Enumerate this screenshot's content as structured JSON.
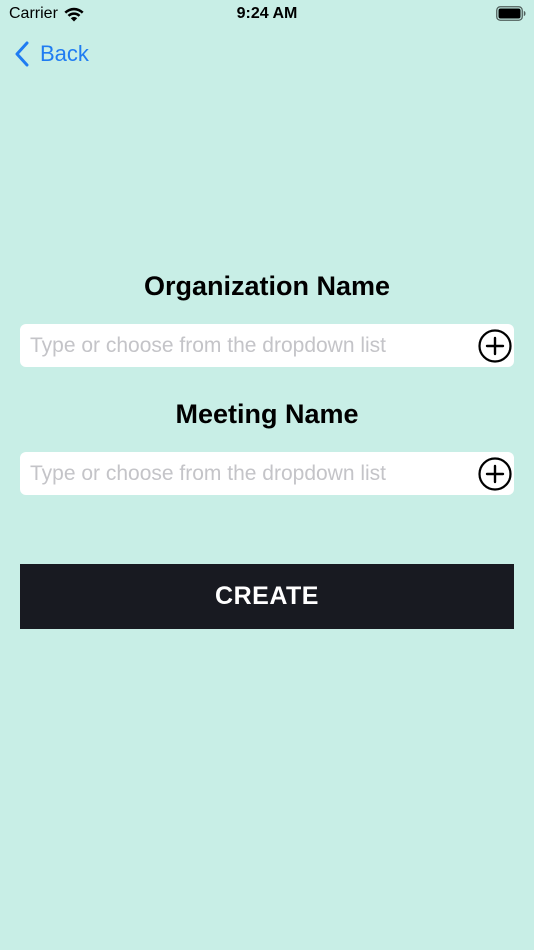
{
  "status_bar": {
    "carrier": "Carrier",
    "time": "9:24 AM",
    "wifi_icon": "wifi-icon",
    "battery_icon": "battery-icon"
  },
  "nav": {
    "back_label": "Back",
    "back_icon": "chevron-left-icon",
    "accent_color": "#1f7cf2"
  },
  "form": {
    "organization": {
      "label": "Organization Name",
      "value": "",
      "placeholder": "Type or choose from the dropdown list",
      "add_icon": "plus-circle-icon"
    },
    "meeting": {
      "label": "Meeting Name",
      "value": "",
      "placeholder": "Type or choose from the dropdown list",
      "add_icon": "plus-circle-icon"
    },
    "create_label": "CREATE"
  },
  "colors": {
    "background": "#c8eee6",
    "button_bg": "#181a21",
    "button_text": "#ffffff",
    "placeholder": "#c4c4c8"
  }
}
